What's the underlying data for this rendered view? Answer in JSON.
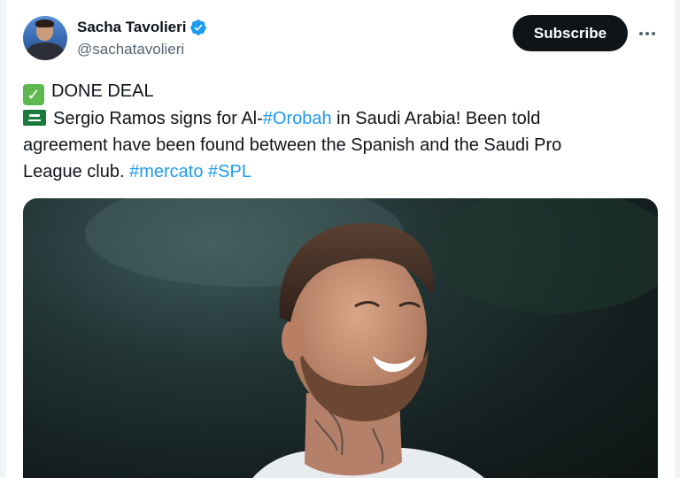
{
  "author": {
    "display_name": "Sacha Tavolieri",
    "handle": "@sachatavolieri",
    "verified": true,
    "verified_color": "#1d9bf0"
  },
  "actions": {
    "subscribe_label": "Subscribe",
    "more_icon": "more-horizontal-icon"
  },
  "tweet": {
    "line1_emoji": "check-mark-button-emoji",
    "line1_text": "DONE DEAL",
    "line2_emoji": "saudi-arabia-flag-emoji",
    "line2_before": "Sergio Ramos signs for Al-",
    "line2_hashtag": "#Orobah",
    "line2_after": " in Saudi Arabia! Been told",
    "line3_text": "agreement have been found between the Spanish and the Saudi Pro",
    "line4_before": "League club. ",
    "hashtag_1": "#mercato",
    "hashtag_2": "#SPL"
  },
  "colors": {
    "text": "#0f1419",
    "secondary_text": "#536471",
    "link": "#1d9bf0",
    "button_bg": "#0f1419"
  }
}
